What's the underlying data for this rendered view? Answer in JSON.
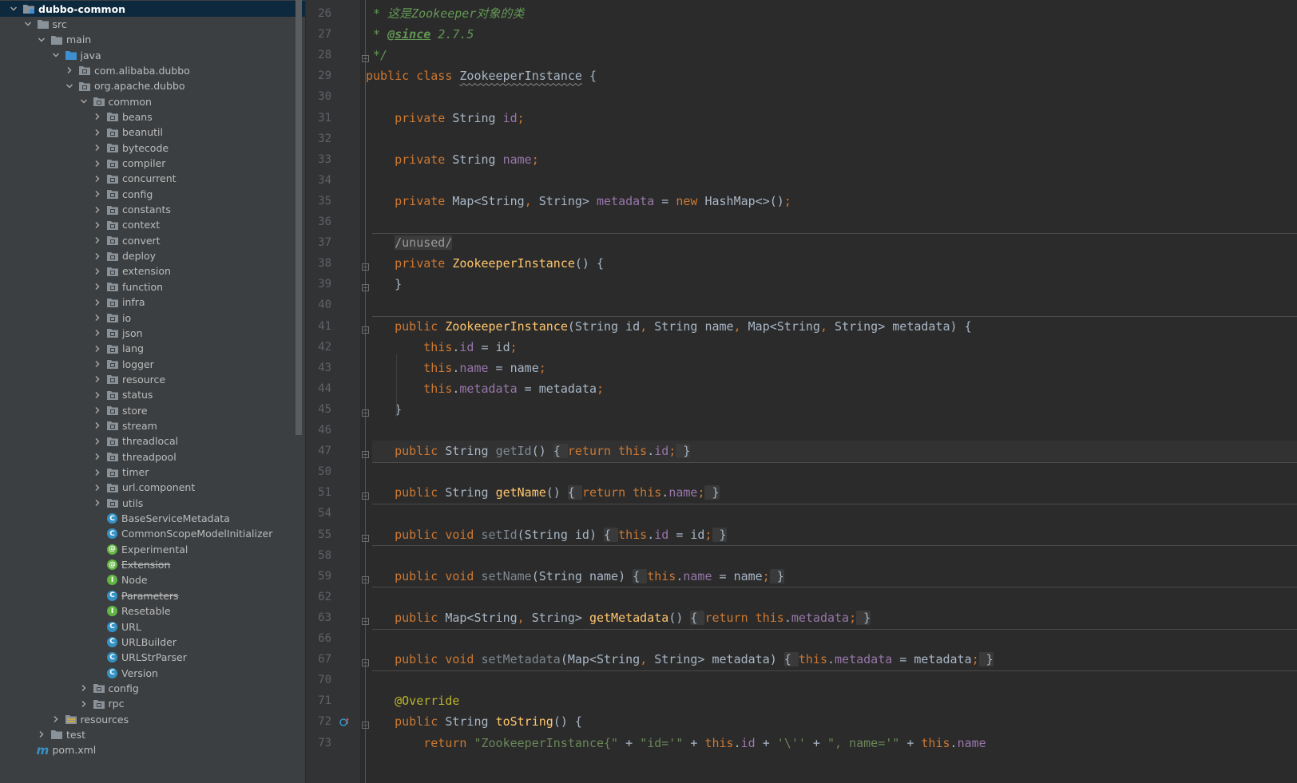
{
  "project_tree": [
    {
      "label": "dubbo-common",
      "depth": 0,
      "expanded": true,
      "type": "module",
      "selected": true
    },
    {
      "label": "src",
      "depth": 1,
      "expanded": true,
      "type": "folder"
    },
    {
      "label": "main",
      "depth": 2,
      "expanded": true,
      "type": "folder"
    },
    {
      "label": "java",
      "depth": 3,
      "expanded": true,
      "type": "source-root"
    },
    {
      "label": "com.alibaba.dubbo",
      "depth": 4,
      "expanded": false,
      "type": "package"
    },
    {
      "label": "org.apache.dubbo",
      "depth": 4,
      "expanded": true,
      "type": "package"
    },
    {
      "label": "common",
      "depth": 5,
      "expanded": true,
      "type": "package"
    },
    {
      "label": "beans",
      "depth": 6,
      "expanded": false,
      "type": "package"
    },
    {
      "label": "beanutil",
      "depth": 6,
      "expanded": false,
      "type": "package"
    },
    {
      "label": "bytecode",
      "depth": 6,
      "expanded": false,
      "type": "package"
    },
    {
      "label": "compiler",
      "depth": 6,
      "expanded": false,
      "type": "package"
    },
    {
      "label": "concurrent",
      "depth": 6,
      "expanded": false,
      "type": "package"
    },
    {
      "label": "config",
      "depth": 6,
      "expanded": false,
      "type": "package"
    },
    {
      "label": "constants",
      "depth": 6,
      "expanded": false,
      "type": "package"
    },
    {
      "label": "context",
      "depth": 6,
      "expanded": false,
      "type": "package"
    },
    {
      "label": "convert",
      "depth": 6,
      "expanded": false,
      "type": "package"
    },
    {
      "label": "deploy",
      "depth": 6,
      "expanded": false,
      "type": "package"
    },
    {
      "label": "extension",
      "depth": 6,
      "expanded": false,
      "type": "package"
    },
    {
      "label": "function",
      "depth": 6,
      "expanded": false,
      "type": "package"
    },
    {
      "label": "infra",
      "depth": 6,
      "expanded": false,
      "type": "package"
    },
    {
      "label": "io",
      "depth": 6,
      "expanded": false,
      "type": "package"
    },
    {
      "label": "json",
      "depth": 6,
      "expanded": false,
      "type": "package"
    },
    {
      "label": "lang",
      "depth": 6,
      "expanded": false,
      "type": "package"
    },
    {
      "label": "logger",
      "depth": 6,
      "expanded": false,
      "type": "package"
    },
    {
      "label": "resource",
      "depth": 6,
      "expanded": false,
      "type": "package"
    },
    {
      "label": "status",
      "depth": 6,
      "expanded": false,
      "type": "package"
    },
    {
      "label": "store",
      "depth": 6,
      "expanded": false,
      "type": "package"
    },
    {
      "label": "stream",
      "depth": 6,
      "expanded": false,
      "type": "package"
    },
    {
      "label": "threadlocal",
      "depth": 6,
      "expanded": false,
      "type": "package"
    },
    {
      "label": "threadpool",
      "depth": 6,
      "expanded": false,
      "type": "package"
    },
    {
      "label": "timer",
      "depth": 6,
      "expanded": false,
      "type": "package"
    },
    {
      "label": "url.component",
      "depth": 6,
      "expanded": false,
      "type": "package"
    },
    {
      "label": "utils",
      "depth": 6,
      "expanded": false,
      "type": "package"
    },
    {
      "label": "BaseServiceMetadata",
      "depth": 6,
      "type": "class"
    },
    {
      "label": "CommonScopeModelInitializer",
      "depth": 6,
      "type": "class"
    },
    {
      "label": "Experimental",
      "depth": 6,
      "type": "annotation"
    },
    {
      "label": "Extension",
      "depth": 6,
      "type": "annotation",
      "deprecated": true
    },
    {
      "label": "Node",
      "depth": 6,
      "type": "interface"
    },
    {
      "label": "Parameters",
      "depth": 6,
      "type": "class",
      "deprecated": true
    },
    {
      "label": "Resetable",
      "depth": 6,
      "type": "interface"
    },
    {
      "label": "URL",
      "depth": 6,
      "type": "class"
    },
    {
      "label": "URLBuilder",
      "depth": 6,
      "type": "class"
    },
    {
      "label": "URLStrParser",
      "depth": 6,
      "type": "class"
    },
    {
      "label": "Version",
      "depth": 6,
      "type": "class"
    },
    {
      "label": "config",
      "depth": 5,
      "expanded": false,
      "type": "package"
    },
    {
      "label": "rpc",
      "depth": 5,
      "expanded": false,
      "type": "package"
    },
    {
      "label": "resources",
      "depth": 3,
      "expanded": false,
      "type": "resources-root"
    },
    {
      "label": "test",
      "depth": 2,
      "expanded": false,
      "type": "folder"
    },
    {
      "label": "pom.xml",
      "depth": 1,
      "type": "maven"
    }
  ],
  "editor": {
    "lines": [
      {
        "n": "26",
        "tokens": [
          [
            "cmt",
            " * 这是Zookeeper对象的类"
          ]
        ]
      },
      {
        "n": "27",
        "tokens": [
          [
            "cmt",
            " * "
          ],
          [
            "tag",
            "@since"
          ],
          [
            "cmt",
            " 2.7.5"
          ]
        ]
      },
      {
        "n": "28",
        "tokens": [
          [
            "cmt",
            " */"
          ]
        ],
        "fold": true
      },
      {
        "n": "29",
        "tokens": [
          [
            "kw",
            "public class "
          ],
          [
            "ul",
            "ZookeeperInstance"
          ],
          [
            "p",
            " {"
          ]
        ]
      },
      {
        "n": "30",
        "tokens": []
      },
      {
        "n": "31",
        "tokens": [
          [
            "p",
            "    "
          ],
          [
            "kw",
            "private "
          ],
          [
            "p",
            "String "
          ],
          [
            "fld",
            "id"
          ],
          [
            "punct",
            ";"
          ]
        ]
      },
      {
        "n": "32",
        "tokens": []
      },
      {
        "n": "33",
        "tokens": [
          [
            "p",
            "    "
          ],
          [
            "kw",
            "private "
          ],
          [
            "p",
            "String "
          ],
          [
            "fld",
            "name"
          ],
          [
            "punct",
            ";"
          ]
        ]
      },
      {
        "n": "34",
        "tokens": []
      },
      {
        "n": "35",
        "tokens": [
          [
            "p",
            "    "
          ],
          [
            "kw",
            "private "
          ],
          [
            "p",
            "Map<String"
          ],
          [
            "punct",
            ", "
          ],
          [
            "p",
            "String> "
          ],
          [
            "fld",
            "metadata"
          ],
          [
            "p",
            " = "
          ],
          [
            "kw",
            "new "
          ],
          [
            "p",
            "HashMap<>()"
          ],
          [
            "punct",
            ";"
          ]
        ]
      },
      {
        "n": "36",
        "tokens": [],
        "sep_after": true
      },
      {
        "n": "37",
        "tokens": [
          [
            "p",
            "    "
          ],
          [
            "unused",
            "/unused/"
          ]
        ]
      },
      {
        "n": "38",
        "tokens": [
          [
            "p",
            "    "
          ],
          [
            "kw",
            "private "
          ],
          [
            "mth",
            "ZookeeperInstance"
          ],
          [
            "p",
            "() {"
          ]
        ],
        "fold": true
      },
      {
        "n": "39",
        "tokens": [
          [
            "p",
            "    }"
          ]
        ],
        "fold": true
      },
      {
        "n": "40",
        "tokens": [],
        "sep_after": true
      },
      {
        "n": "41",
        "tokens": [
          [
            "p",
            "    "
          ],
          [
            "kw",
            "public "
          ],
          [
            "mth",
            "ZookeeperInstance"
          ],
          [
            "p",
            "(String id"
          ],
          [
            "punct",
            ", "
          ],
          [
            "p",
            "String name"
          ],
          [
            "punct",
            ", "
          ],
          [
            "p",
            "Map<String"
          ],
          [
            "punct",
            ", "
          ],
          [
            "p",
            "String> metadata) {"
          ]
        ],
        "fold": true
      },
      {
        "n": "42",
        "tokens": [
          [
            "p",
            "        "
          ],
          [
            "kw",
            "this"
          ],
          [
            "p",
            "."
          ],
          [
            "fld",
            "id"
          ],
          [
            "p",
            " = id"
          ],
          [
            "punct",
            ";"
          ]
        ]
      },
      {
        "n": "43",
        "tokens": [
          [
            "p",
            "        "
          ],
          [
            "kw",
            "this"
          ],
          [
            "p",
            "."
          ],
          [
            "fld",
            "name"
          ],
          [
            "p",
            " = name"
          ],
          [
            "punct",
            ";"
          ]
        ]
      },
      {
        "n": "44",
        "tokens": [
          [
            "p",
            "        "
          ],
          [
            "kw",
            "this"
          ],
          [
            "p",
            "."
          ],
          [
            "fld",
            "metadata"
          ],
          [
            "p",
            " = metadata"
          ],
          [
            "punct",
            ";"
          ]
        ]
      },
      {
        "n": "45",
        "tokens": [
          [
            "p",
            "    }"
          ]
        ],
        "fold": true
      },
      {
        "n": "46",
        "tokens": [],
        "sep_after": true
      },
      {
        "n": "47",
        "tokens": [
          [
            "p",
            "    "
          ],
          [
            "kw",
            "public "
          ],
          [
            "p",
            "String "
          ],
          [
            "mthg",
            "getId"
          ],
          [
            "p",
            "() "
          ],
          [
            "fb",
            "{ "
          ],
          [
            "kw",
            "return this"
          ],
          [
            "p",
            "."
          ],
          [
            "fld",
            "id"
          ],
          [
            "punct",
            ";"
          ],
          [
            "fb",
            " }"
          ]
        ],
        "fold": true,
        "highlight": true,
        "sep_after": true
      },
      {
        "n": "50",
        "tokens": [],
        "sep_after": false
      },
      {
        "n": "51",
        "tokens": [
          [
            "p",
            "    "
          ],
          [
            "kw",
            "public "
          ],
          [
            "p",
            "String "
          ],
          [
            "mth",
            "getName"
          ],
          [
            "p",
            "() "
          ],
          [
            "fb",
            "{ "
          ],
          [
            "kw",
            "return this"
          ],
          [
            "p",
            "."
          ],
          [
            "fld",
            "name"
          ],
          [
            "punct",
            ";"
          ],
          [
            "fb",
            " }"
          ]
        ],
        "fold": true,
        "sep_after": true
      },
      {
        "n": "54",
        "tokens": []
      },
      {
        "n": "55",
        "tokens": [
          [
            "p",
            "    "
          ],
          [
            "kw",
            "public void "
          ],
          [
            "mthg",
            "setId"
          ],
          [
            "p",
            "(String id) "
          ],
          [
            "fb",
            "{ "
          ],
          [
            "kw",
            "this"
          ],
          [
            "p",
            "."
          ],
          [
            "fld",
            "id"
          ],
          [
            "p",
            " = id"
          ],
          [
            "punct",
            ";"
          ],
          [
            "fb",
            " }"
          ]
        ],
        "fold": true,
        "sep_after": true
      },
      {
        "n": "58",
        "tokens": []
      },
      {
        "n": "59",
        "tokens": [
          [
            "p",
            "    "
          ],
          [
            "kw",
            "public void "
          ],
          [
            "mthg",
            "setName"
          ],
          [
            "p",
            "(String name) "
          ],
          [
            "fb",
            "{ "
          ],
          [
            "kw",
            "this"
          ],
          [
            "p",
            "."
          ],
          [
            "fld",
            "name"
          ],
          [
            "p",
            " = name"
          ],
          [
            "punct",
            ";"
          ],
          [
            "fb",
            " }"
          ]
        ],
        "fold": true,
        "sep_after": true
      },
      {
        "n": "62",
        "tokens": []
      },
      {
        "n": "63",
        "tokens": [
          [
            "p",
            "    "
          ],
          [
            "kw",
            "public "
          ],
          [
            "p",
            "Map<String"
          ],
          [
            "punct",
            ", "
          ],
          [
            "p",
            "String> "
          ],
          [
            "mth",
            "getMetadata"
          ],
          [
            "p",
            "() "
          ],
          [
            "fb",
            "{ "
          ],
          [
            "kw",
            "return this"
          ],
          [
            "p",
            "."
          ],
          [
            "fld",
            "metadata"
          ],
          [
            "punct",
            ";"
          ],
          [
            "fb",
            " }"
          ]
        ],
        "fold": true,
        "sep_after": true
      },
      {
        "n": "66",
        "tokens": []
      },
      {
        "n": "67",
        "tokens": [
          [
            "p",
            "    "
          ],
          [
            "kw",
            "public void "
          ],
          [
            "mthg",
            "setMetadata"
          ],
          [
            "p",
            "(Map<String"
          ],
          [
            "punct",
            ", "
          ],
          [
            "p",
            "String> metadata) "
          ],
          [
            "fb",
            "{ "
          ],
          [
            "kw",
            "this"
          ],
          [
            "p",
            "."
          ],
          [
            "fld",
            "metadata"
          ],
          [
            "p",
            " = metadata"
          ],
          [
            "punct",
            ";"
          ],
          [
            "fb",
            " }"
          ]
        ],
        "fold": true,
        "sep_after": true
      },
      {
        "n": "70",
        "tokens": []
      },
      {
        "n": "71",
        "tokens": [
          [
            "p",
            "    "
          ],
          [
            "ann",
            "@Override"
          ]
        ]
      },
      {
        "n": "72",
        "tokens": [
          [
            "p",
            "    "
          ],
          [
            "kw",
            "public "
          ],
          [
            "p",
            "String "
          ],
          [
            "mth",
            "toString"
          ],
          [
            "p",
            "() {"
          ]
        ],
        "fold": true,
        "override": true
      },
      {
        "n": "73",
        "tokens": [
          [
            "p",
            "        "
          ],
          [
            "kw",
            "return "
          ],
          [
            "str",
            "\"ZookeeperInstance{\""
          ],
          [
            "p",
            " + "
          ],
          [
            "str",
            "\"id='\""
          ],
          [
            "p",
            " + "
          ],
          [
            "kw",
            "this"
          ],
          [
            "p",
            "."
          ],
          [
            "fld",
            "id"
          ],
          [
            "p",
            " + "
          ],
          [
            "str",
            "'\\''"
          ],
          [
            "p",
            " + "
          ],
          [
            "str",
            "\", name='\""
          ],
          [
            "p",
            " + "
          ],
          [
            "kw",
            "this"
          ],
          [
            "p",
            "."
          ],
          [
            "fld",
            "name"
          ]
        ]
      }
    ]
  },
  "colors": {
    "sidebar_bg": "#3c3f41",
    "editor_bg": "#2b2b2b",
    "gutter_bg": "#313335",
    "keyword": "#cc7832",
    "field": "#9876aa",
    "method": "#ffc66d",
    "string": "#6a8759",
    "comment": "#629755",
    "selection": "#0d293e"
  }
}
